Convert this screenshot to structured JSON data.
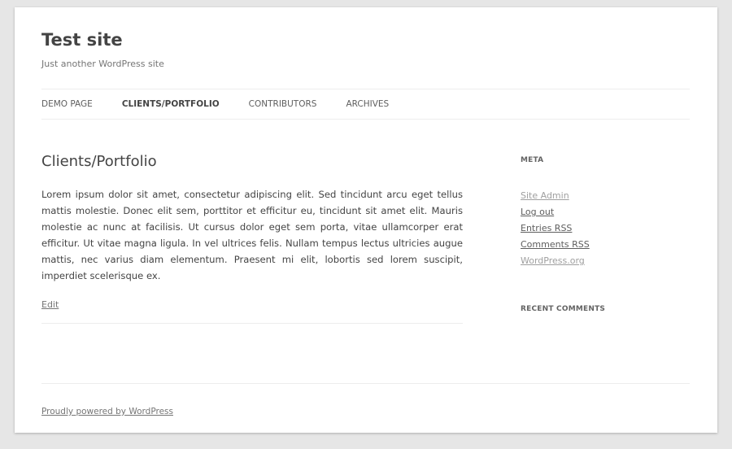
{
  "site": {
    "title": "Test site",
    "description": "Just another WordPress site"
  },
  "nav": {
    "items": [
      {
        "label": "Demo Page",
        "current": false
      },
      {
        "label": "Clients/Portfolio",
        "current": true
      },
      {
        "label": "Contributors",
        "current": false
      },
      {
        "label": "Archives",
        "current": false
      }
    ]
  },
  "entry": {
    "title": "Clients/Portfolio",
    "body": "Lorem ipsum dolor sit amet, consectetur adipiscing elit. Sed tincidunt arcu eget tellus mattis molestie. Donec elit sem, porttitor et efficitur eu, tincidunt sit amet elit. Mauris molestie ac nunc at facilisis. Ut cursus dolor eget sem porta, vitae ullamcorper erat efficitur. Ut vitae magna ligula. In vel ultrices felis. Nullam tempus lectus ultricies augue mattis, nec varius diam elementum. Praesent mi elit, lobortis sed lorem suscipit, imperdiet scelerisque ex.",
    "edit_label": "Edit"
  },
  "sidebar": {
    "meta_title": "Meta",
    "meta_links": [
      {
        "label": "Site Admin"
      },
      {
        "label": "Log out"
      },
      {
        "label": "Entries RSS"
      },
      {
        "label": "Comments RSS"
      },
      {
        "label": "WordPress.org"
      }
    ],
    "recent_comments_title": "Recent Comments"
  },
  "footer": {
    "credit": "Proudly powered by WordPress"
  },
  "colors": {
    "background": "#e6e6e6",
    "page": "#ffffff",
    "text": "#444444",
    "muted_link": "#9f9f9f"
  }
}
